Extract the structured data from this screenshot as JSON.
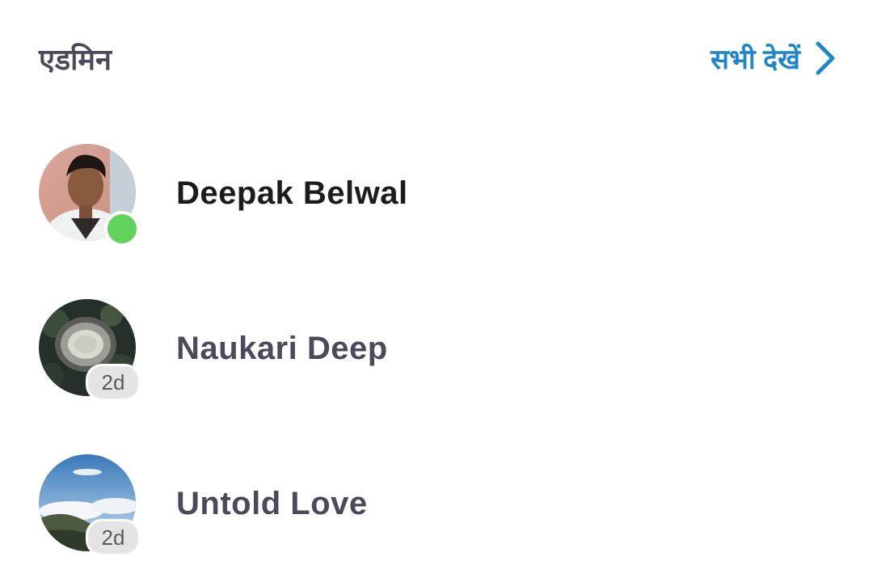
{
  "section": {
    "title": "एडमिन",
    "see_all_label": "सभी देखें"
  },
  "colors": {
    "accent": "#1f86c7",
    "online": "#62d45e",
    "muted_text": "#4a4a5a"
  },
  "admins": [
    {
      "name": "Deepak Belwal",
      "status": "online",
      "avatar": "profile-photo"
    },
    {
      "name": "Naukari Deep",
      "status_label": "2d",
      "avatar": "aerial-stadium-photo"
    },
    {
      "name": "Untold Love",
      "status_label": "2d",
      "avatar": "sky-landscape-photo"
    }
  ]
}
